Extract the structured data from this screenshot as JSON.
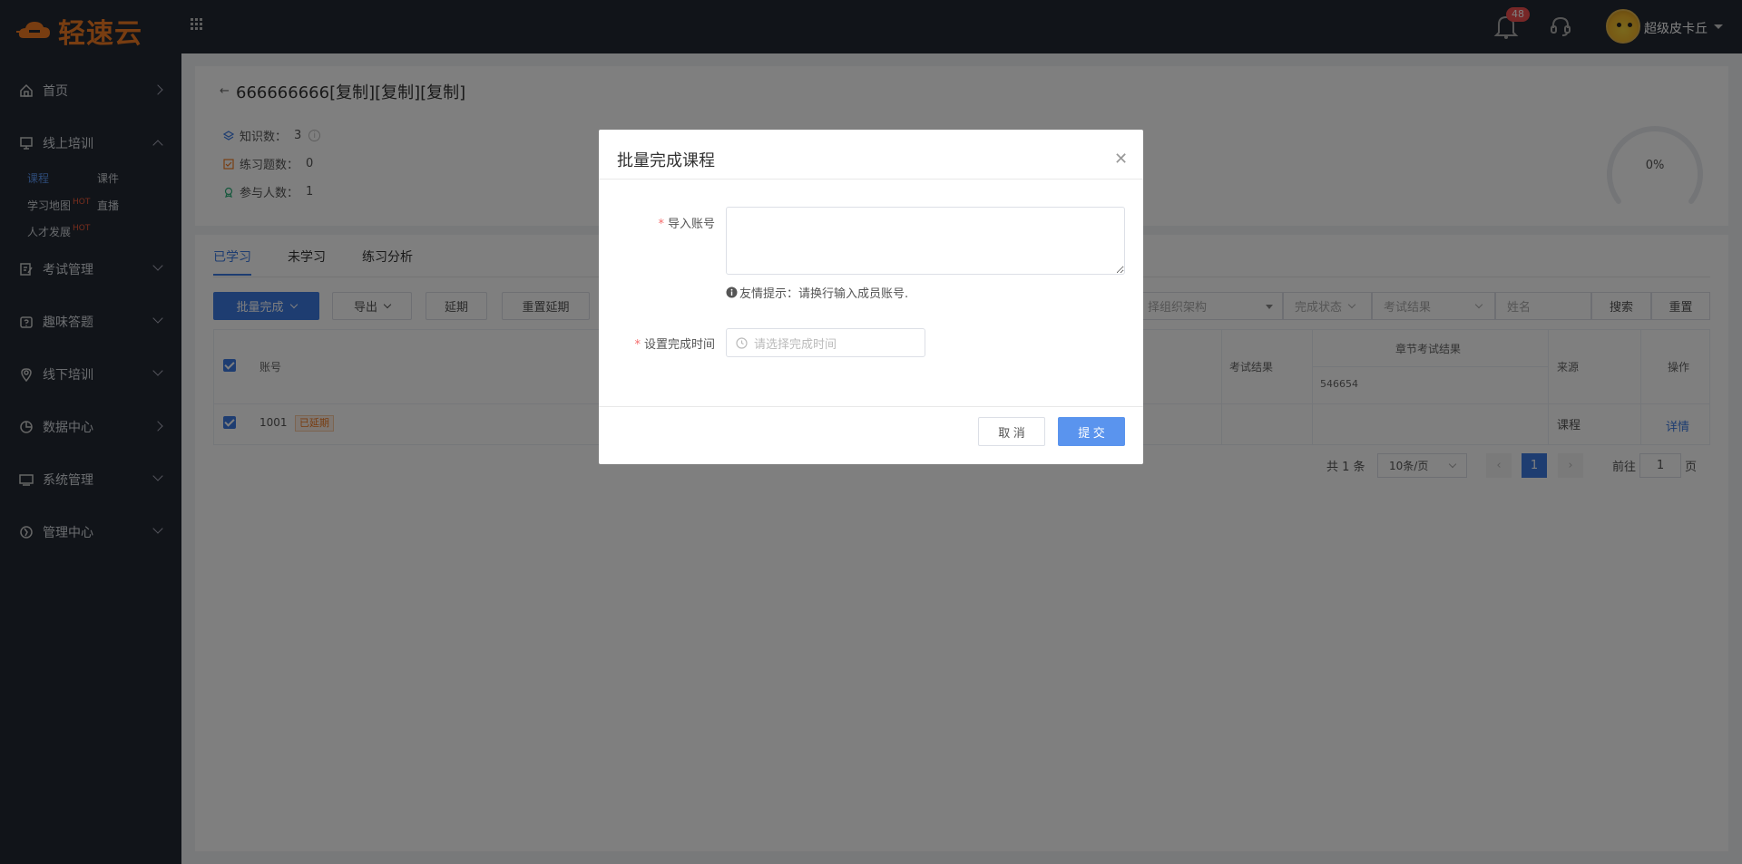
{
  "header": {
    "logo_text": "轻速云",
    "notification_count": "48",
    "username": "超级皮卡丘"
  },
  "sidebar": {
    "items": [
      {
        "label": "首页",
        "icon": "home-icon",
        "expanded": false
      },
      {
        "label": "线上培训",
        "icon": "monitor-icon",
        "expanded": true
      },
      {
        "label": "考试管理",
        "icon": "exam-icon",
        "expanded": false
      },
      {
        "label": "趣味答题",
        "icon": "quiz-icon",
        "expanded": false
      },
      {
        "label": "线下培训",
        "icon": "location-icon",
        "expanded": false
      },
      {
        "label": "数据中心",
        "icon": "chart-icon",
        "expanded": false
      },
      {
        "label": "系统管理",
        "icon": "desktop-icon",
        "expanded": false
      },
      {
        "label": "管理中心",
        "icon": "admin-icon",
        "expanded": false
      }
    ],
    "subitems": {
      "course": "课程",
      "courseware": "课件",
      "learning_map": "学习地图",
      "live": "直播",
      "talent": "人才发展",
      "hot": "HOT"
    }
  },
  "course": {
    "title": "666666666[复制][复制][复制]",
    "knowledge_label": "知识数：",
    "knowledge_count": "3",
    "practice_label": "练习题数：",
    "practice_count": "0",
    "participants_label": "参与人数：",
    "participants_count": "1",
    "progress": "0%",
    "progress_value": 0
  },
  "tabs": [
    "已学习",
    "未学习",
    "练习分析"
  ],
  "toolbar": {
    "batch_complete": "批量完成",
    "export": "导出",
    "extend": "延期",
    "reset_extend": "重置延期"
  },
  "filters": {
    "org": "择组织架构",
    "status": "完成状态",
    "exam": "考试结果",
    "name_placeholder": "姓名",
    "search": "搜索",
    "reset": "重置"
  },
  "table": {
    "headers": {
      "account": "账号",
      "exam_result": "考试结果",
      "chapter_exam": "章节考试结果",
      "chapter_id": "546654",
      "source": "来源",
      "action": "操作"
    },
    "rows": [
      {
        "account": "1001",
        "tag": "已延期",
        "source": "课程",
        "action": "详情"
      }
    ]
  },
  "pagination": {
    "total": "共 1 条",
    "page_size": "10条/页",
    "current": "1",
    "goto_label": "前往",
    "goto_value": "1",
    "page_suffix": "页"
  },
  "dialog": {
    "title": "批量完成课程",
    "import_label": "导入账号",
    "hint": "友情提示：请换行输入成员账号.",
    "time_label": "设置完成时间",
    "time_placeholder": "请选择完成时间",
    "cancel": "取 消",
    "submit": "提 交"
  },
  "colors": {
    "accent": "#3d7be2",
    "brand": "#f07a23",
    "sidebar": "#232933",
    "danger": "#f56c6c"
  }
}
